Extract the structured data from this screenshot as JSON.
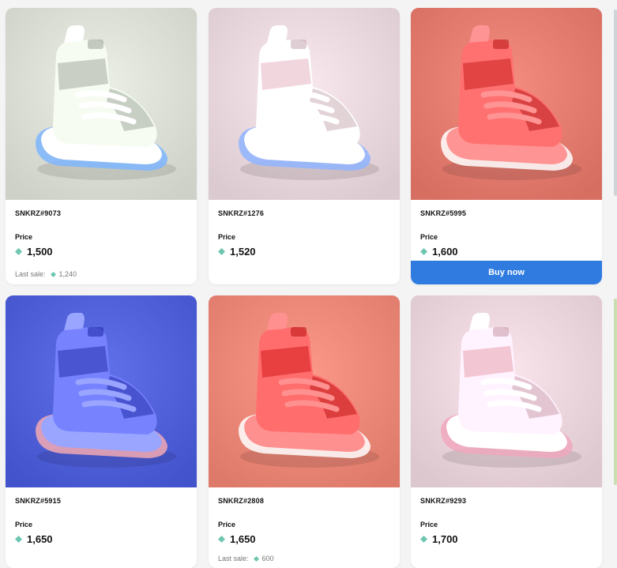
{
  "cards": [
    {
      "name": "SNKRZ#9073",
      "price_label": "Price",
      "price": "1,500",
      "last_sale_label": "Last sale:",
      "last_sale": "1,240",
      "bg": "#d9ddd3",
      "accent": "#c9cfc4",
      "glow": "#7fb6ff"
    },
    {
      "name": "SNKRZ#1276",
      "price_label": "Price",
      "price": "1,520",
      "bg": "#e7d6dc",
      "accent": "#f2d6de",
      "glow": "#8fb4ff"
    },
    {
      "name": "SNKRZ#5995",
      "price_label": "Price",
      "price": "1,600",
      "buy_label": "Buy now",
      "bg": "#e27a6e",
      "accent": "#e24444",
      "glow": "#ffffff"
    },
    {
      "name": "SNKRZ#5915",
      "price_label": "Price",
      "price": "1,650",
      "bg": "#4f5fd8",
      "accent": "#4a55d2",
      "glow": "#f3a9b3"
    },
    {
      "name": "SNKRZ#2808",
      "price_label": "Price",
      "price": "1,650",
      "last_sale_label": "Last sale:",
      "last_sale": "600",
      "bg": "#ea8676",
      "accent": "#e84040",
      "glow": "#ffffff"
    },
    {
      "name": "SNKRZ#9293",
      "price_label": "Price",
      "price": "1,700",
      "bg": "#e9d3da",
      "accent": "#f3c6d3",
      "glow": "#f0a8bd"
    }
  ],
  "icons": {
    "currency": "diamond-icon"
  },
  "colors": {
    "buy_button": "#2f7be0",
    "currency": "#6ec6b0"
  }
}
